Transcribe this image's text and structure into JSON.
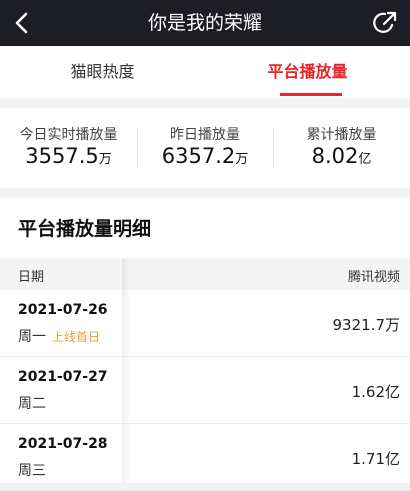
{
  "header": {
    "title": "你是我的荣耀",
    "back_icon": "back-chevron-icon",
    "share_icon": "share-icon"
  },
  "tabs": [
    {
      "label": "猫眼热度",
      "active": false
    },
    {
      "label": "平台播放量",
      "active": true
    }
  ],
  "colors": {
    "accent": "#e8262a",
    "titlebar_bg": "#1d1d27",
    "tag": "#e6a23c"
  },
  "stats": [
    {
      "label": "今日实时播放量",
      "value": "3557.5",
      "unit": "万"
    },
    {
      "label": "昨日播放量",
      "value": "6357.2",
      "unit": "万"
    },
    {
      "label": "累计播放量",
      "value": "8.02",
      "unit": "亿"
    }
  ],
  "detail": {
    "title": "平台播放量明细",
    "columns": {
      "date": "日期",
      "source": "腾讯视频"
    },
    "rows": [
      {
        "date": "2021-07-26",
        "weekday": "周一",
        "tag": "上线首日",
        "value": "9321.7万"
      },
      {
        "date": "2021-07-27",
        "weekday": "周二",
        "tag": "",
        "value": "1.62亿"
      },
      {
        "date": "2021-07-28",
        "weekday": "周三",
        "tag": "",
        "value": "1.71亿"
      }
    ]
  }
}
